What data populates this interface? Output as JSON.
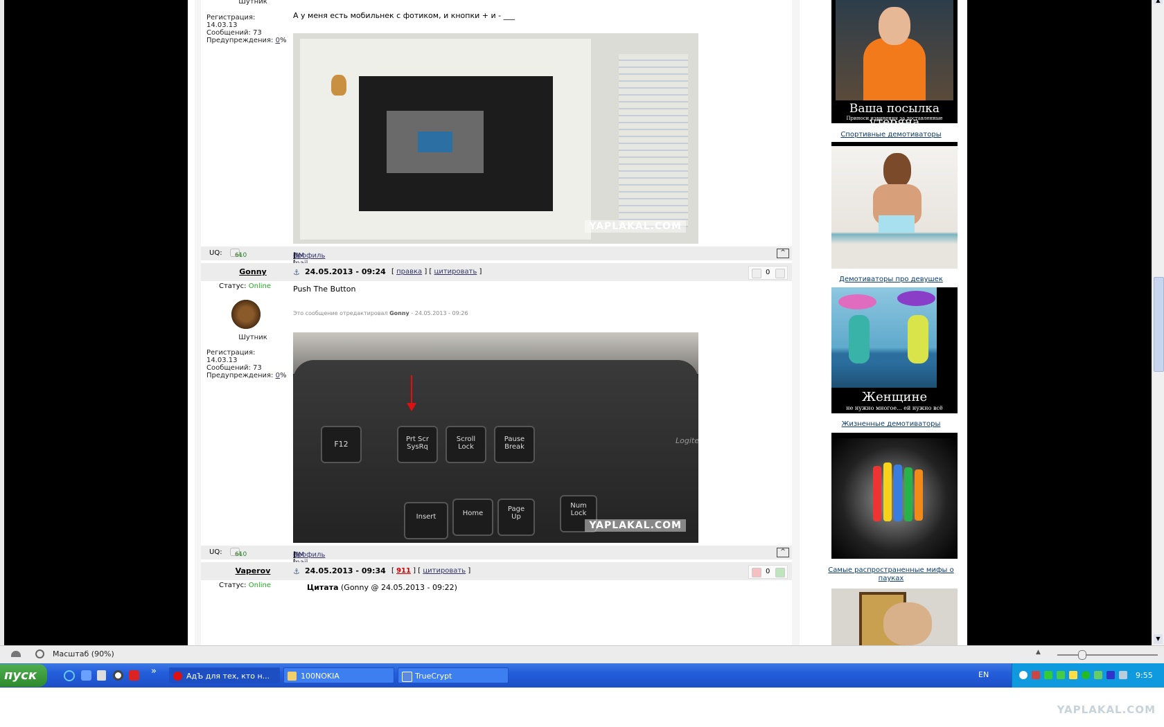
{
  "post1": {
    "rank": "Шутник",
    "reg_label": "Регистрация:",
    "reg_date": "14.03.13",
    "msgs": "Сообщений: 73",
    "warn_label": "Предупреждения:",
    "warn_val": "0",
    "warn_pct": "%",
    "text": "А у меня есть мобильнек с фотиком, и кнопки + и - ___",
    "uq_label": "UQ:",
    "karma": "610"
  },
  "bar_links": {
    "open": "[",
    "profile": "профиль",
    "sep": "] [",
    "pm": "ПМ",
    "email": "e-mail",
    "close": "]"
  },
  "post2": {
    "nick": "Gonny",
    "date": "24.05.2013 - 09:24",
    "edit": "правка",
    "quote": "цитировать",
    "votes": "0",
    "status_label": "Статус:",
    "status": "Online",
    "rank": "Шутник",
    "reg_label": "Регистрация:",
    "reg_date": "14.03.13",
    "msgs": "Сообщений: 73",
    "warn_label": "Предупреждения:",
    "warn_val": "0",
    "warn_pct": "%",
    "text": "Push The Button",
    "edited_prefix": "Это сообщение отредактировал",
    "edited_by": "Gonny",
    "edited_when": "- 24.05.2013 - 09:26",
    "uq_label": "UQ:",
    "karma": "610",
    "keys": {
      "f12": "F12",
      "prt1": "Prt Scr",
      "prt2": "SysRq",
      "scr1": "Scroll",
      "scr2": "Lock",
      "pau1": "Pause",
      "pau2": "Break",
      "ins": "Insert",
      "home": "Home",
      "pgup1": "Page",
      "pgup2": "Up",
      "num1": "Num",
      "num2": "Lock",
      "brand": "Logitec"
    }
  },
  "post3": {
    "nick": "Vaperov",
    "date": "24.05.2013 - 09:34",
    "num": "911",
    "quote": "цитировать",
    "votes": "0",
    "status_label": "Статус:",
    "status": "Online",
    "quote_title": "Цитата",
    "quote_meta": "(Gonny @ 24.05.2013 - 09:22)"
  },
  "watermark": "YAPLAKAL.COM",
  "sidebar": {
    "demo1_caption": "Ваша посылка утеряна",
    "demo1_sub": "Приноси извинения за доставленные неудобства",
    "link1": "Спортивные демотиваторы",
    "link2": "Демотиваторы про девушек",
    "demo3_caption": "Женщине",
    "demo3_sub": "не нужно многое... ей нужно всё",
    "link3": "Жизненные демотиваторы",
    "link4": "Самые распространенные мифы о пауках"
  },
  "statusbar": {
    "zoom": "Масштаб (90%)"
  },
  "taskbar": {
    "start": "пуск",
    "more": "»",
    "tasks": [
      "АдЪ для тех, кто н...",
      "100NOKIA",
      "TrueCrypt"
    ],
    "lang": "EN",
    "clock": "9:55"
  },
  "footer_watermark": "YAPLAKAL.COM"
}
